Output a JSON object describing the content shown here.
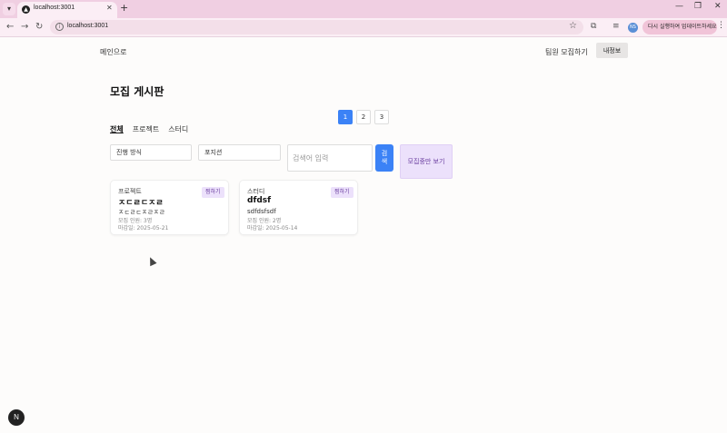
{
  "browser": {
    "tab_title": "localhost:3001",
    "url": "localhost:3001",
    "update_text": "다시 실행하여 업데이트하세요",
    "profile_initials": "NS"
  },
  "nav": {
    "main_link": "메인으로",
    "recruit_link": "팀원 모집하기",
    "myinfo_button": "내정보"
  },
  "page": {
    "title": "모집 게시판"
  },
  "pagination": [
    "1",
    "2",
    "3"
  ],
  "filters": {
    "tabs": [
      "전체",
      "프로젝트",
      "스터디"
    ],
    "mode_select": "진행 방식",
    "position_select": "포지션",
    "search_placeholder": "검색어 입력",
    "search_button": "검색",
    "open_only_button": "모집중만 보기"
  },
  "cards": [
    {
      "category": "프로젝트",
      "title": "ㅈㄷㄹㄷㅈㄹ",
      "desc": "ㅈㄷㄹㄷㅈㄹㅈㄹ",
      "members": "모집 인원: 3명",
      "deadline": "마감일: 2025-05-21",
      "zzim": "찜하기"
    },
    {
      "category": "스터디",
      "title": "dfdsf",
      "desc": "sdfdsfsdf",
      "members": "모집 인원: 2명",
      "deadline": "마감일: 2025-05-14",
      "zzim": "찜하기"
    }
  ],
  "dev_badge": "N"
}
